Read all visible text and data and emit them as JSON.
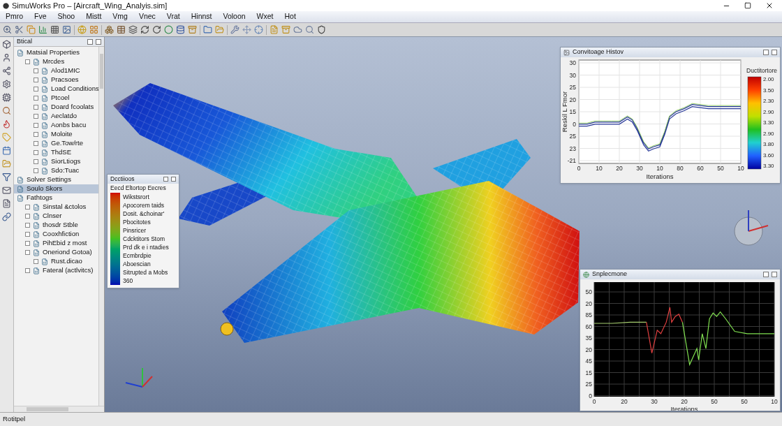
{
  "window": {
    "title": "SimuWorks Pro – [Aircraft_Wing_Analyis.sim]"
  },
  "menu": [
    "Pmro",
    "Fve",
    "Shoo",
    "Mistt",
    "Vmg",
    "Vnec",
    "Vrat",
    "Hinnst",
    "Voloon",
    "Wxet",
    "Hot"
  ],
  "tree_panel": {
    "title": "Btical",
    "items": [
      {
        "label": "Matsial Properties",
        "selected": false,
        "children": [
          {
            "label": "Mrcdes",
            "selected": false,
            "children": [
              {
                "label": "Alod1MIC",
                "selected": false
              },
              {
                "label": "Pracsoes",
                "selected": false
              },
              {
                "label": "Load Conditions",
                "selected": false
              },
              {
                "label": "Ptcoel",
                "selected": false
              },
              {
                "label": "Doard fcoolats",
                "selected": false
              },
              {
                "label": "Aeclatdo",
                "selected": false
              },
              {
                "label": "Aonbs bacu",
                "selected": false
              },
              {
                "label": "Moloite",
                "selected": false
              },
              {
                "label": "Ge.Tow/rte",
                "selected": false
              },
              {
                "label": "ThdSE",
                "selected": false
              },
              {
                "label": "SiorLtiogs",
                "selected": false
              },
              {
                "label": "Sdo:Tuac",
                "selected": false
              }
            ]
          }
        ]
      },
      {
        "label": "Solver Settings",
        "selected": false
      },
      {
        "label": "Soulo Skors",
        "selected": true
      },
      {
        "label": "Fathtogs",
        "selected": false,
        "children": [
          {
            "label": "Sinstal &ctolos",
            "selected": false
          },
          {
            "label": "Clnser",
            "selected": false
          },
          {
            "label": "thosdr Stble",
            "selected": false
          },
          {
            "label": "Cooxhfiction",
            "selected": false
          },
          {
            "label": "PihEbid z most",
            "selected": false
          },
          {
            "label": "Oneriond Gotoa)",
            "selected": false,
            "children": [
              {
                "label": "Rust.dicao",
                "selected": false
              }
            ]
          },
          {
            "label": "Fateral (actlvitcs)",
            "selected": false
          }
        ]
      }
    ]
  },
  "legend_panel": {
    "title": "Dcctiioos",
    "heading": "Eecd Eltortop Eecres",
    "labels": [
      "Wikstsrort",
      "Apocorem taids",
      "Dosit. &choinar'",
      "Pbocitotes",
      "Pinsricer",
      "Cdcktitors Stom",
      "Prd dk e i ntadies",
      "Ecmbrdpie",
      "Aboescian",
      "Sitrupted a Mobs",
      "360"
    ]
  },
  "convergence_panel": {
    "title": "Convitoage Histov",
    "ylabel": "Reskil L Fmor",
    "xlabel": "Iterations",
    "yticks": [
      "30",
      "30",
      "25",
      "20",
      "15",
      "0",
      "25",
      "23",
      "-21"
    ],
    "xticks": [
      "0",
      "10",
      "20",
      "30",
      "10",
      "80",
      "60",
      "50",
      "10"
    ],
    "colorbar": {
      "title": "Ductitortore",
      "ticks": [
        "2.00",
        "3.50",
        "2.30",
        "2.90",
        "3.30",
        "2.90",
        "3.80",
        "3.60",
        "3.30"
      ]
    }
  },
  "monitor_panel": {
    "title": "Snplecmone",
    "xlabel": "Iterations",
    "yticks": [
      "50",
      "20",
      "85",
      "60",
      "35",
      "20",
      "45",
      "15",
      "25",
      "0"
    ],
    "xticks": [
      "0",
      "20",
      "30",
      "20",
      "50",
      "50",
      "10"
    ]
  },
  "status_bar": "Rotitpel"
}
